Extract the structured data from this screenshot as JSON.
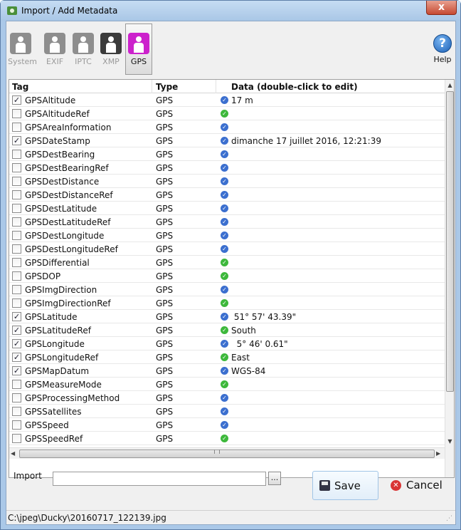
{
  "window": {
    "title": "Import / Add Metadata",
    "close_label": "x"
  },
  "toolbar": {
    "buttons": [
      {
        "label": "System",
        "icon": "person-icon"
      },
      {
        "label": "EXIF",
        "icon": "person-icon"
      },
      {
        "label": "IPTC",
        "icon": "person-icon"
      },
      {
        "label": "XMP",
        "icon": "person-icon"
      },
      {
        "label": "GPS",
        "icon": "person-icon",
        "selected": true
      }
    ],
    "help_label": "Help",
    "help_glyph": "?",
    "colors": {
      "disabled_icon": "#8e8e8e",
      "xmp_icon": "#3b3b3b",
      "gps_icon": "#cc22cc"
    }
  },
  "grid": {
    "headers": {
      "tag": "Tag",
      "type": "Type",
      "data": "Data  (double-click to edit)"
    },
    "check_glyph": "✓",
    "status_glyph": "✓",
    "rows": [
      {
        "tag": "GPSAltitude",
        "type": "GPS",
        "checked": true,
        "status": "blue",
        "value": "17 m"
      },
      {
        "tag": "GPSAltitudeRef",
        "type": "GPS",
        "checked": false,
        "status": "green",
        "value": ""
      },
      {
        "tag": "GPSAreaInformation",
        "type": "GPS",
        "checked": false,
        "status": "blue",
        "value": ""
      },
      {
        "tag": "GPSDateStamp",
        "type": "GPS",
        "checked": true,
        "status": "blue",
        "value": "dimanche 17 juillet 2016, 12:21:39"
      },
      {
        "tag": "GPSDestBearing",
        "type": "GPS",
        "checked": false,
        "status": "blue",
        "value": ""
      },
      {
        "tag": "GPSDestBearingRef",
        "type": "GPS",
        "checked": false,
        "status": "blue",
        "value": ""
      },
      {
        "tag": "GPSDestDistance",
        "type": "GPS",
        "checked": false,
        "status": "blue",
        "value": ""
      },
      {
        "tag": "GPSDestDistanceRef",
        "type": "GPS",
        "checked": false,
        "status": "blue",
        "value": ""
      },
      {
        "tag": "GPSDestLatitude",
        "type": "GPS",
        "checked": false,
        "status": "blue",
        "value": ""
      },
      {
        "tag": "GPSDestLatitudeRef",
        "type": "GPS",
        "checked": false,
        "status": "blue",
        "value": ""
      },
      {
        "tag": "GPSDestLongitude",
        "type": "GPS",
        "checked": false,
        "status": "blue",
        "value": ""
      },
      {
        "tag": "GPSDestLongitudeRef",
        "type": "GPS",
        "checked": false,
        "status": "blue",
        "value": ""
      },
      {
        "tag": "GPSDifferential",
        "type": "GPS",
        "checked": false,
        "status": "green",
        "value": ""
      },
      {
        "tag": "GPSDOP",
        "type": "GPS",
        "checked": false,
        "status": "green",
        "value": ""
      },
      {
        "tag": "GPSImgDirection",
        "type": "GPS",
        "checked": false,
        "status": "blue",
        "value": ""
      },
      {
        "tag": "GPSImgDirectionRef",
        "type": "GPS",
        "checked": false,
        "status": "green",
        "value": ""
      },
      {
        "tag": "GPSLatitude",
        "type": "GPS",
        "checked": true,
        "status": "blue",
        "value": " 51° 57' 43.39\""
      },
      {
        "tag": "GPSLatitudeRef",
        "type": "GPS",
        "checked": true,
        "status": "green",
        "value": "South"
      },
      {
        "tag": "GPSLongitude",
        "type": "GPS",
        "checked": true,
        "status": "blue",
        "value": "  5° 46' 0.61\""
      },
      {
        "tag": "GPSLongitudeRef",
        "type": "GPS",
        "checked": true,
        "status": "green",
        "value": "East"
      },
      {
        "tag": "GPSMapDatum",
        "type": "GPS",
        "checked": true,
        "status": "blue",
        "value": "WGS-84"
      },
      {
        "tag": "GPSMeasureMode",
        "type": "GPS",
        "checked": false,
        "status": "green",
        "value": ""
      },
      {
        "tag": "GPSProcessingMethod",
        "type": "GPS",
        "checked": false,
        "status": "blue",
        "value": ""
      },
      {
        "tag": "GPSSatellites",
        "type": "GPS",
        "checked": false,
        "status": "blue",
        "value": ""
      },
      {
        "tag": "GPSSpeed",
        "type": "GPS",
        "checked": false,
        "status": "blue",
        "value": ""
      },
      {
        "tag": "GPSSpeedRef",
        "type": "GPS",
        "checked": false,
        "status": "green",
        "value": ""
      }
    ]
  },
  "import": {
    "label": "Import",
    "value": "",
    "browse_label": "..."
  },
  "actions": {
    "save_label": "Save",
    "cancel_label": "Cancel"
  },
  "status": {
    "path": "C:\\jpeg\\Ducky\\20160717_122139.jpg"
  },
  "scrollbar": {
    "up": "▲",
    "down": "▼",
    "left": "◀",
    "right": "▶"
  }
}
